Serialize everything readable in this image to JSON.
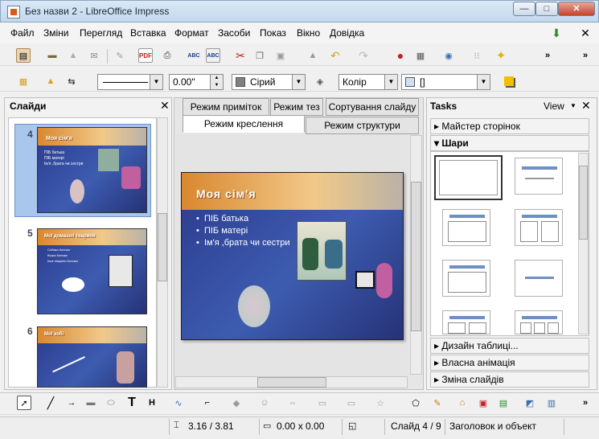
{
  "window": {
    "title": "Без назви 2 - LibreOffice Impress",
    "minimize": "—",
    "maximize": "□",
    "close": "✕"
  },
  "menu": {
    "items": [
      "Файл",
      "Зміни",
      "Перегляд",
      "Вставка",
      "Формат",
      "Засоби",
      "Показ",
      "Вікно",
      "Довідка"
    ]
  },
  "line_toolbar": {
    "line_width": "0.00\"",
    "area_style": "Сірий",
    "area_fill_type": "Колір",
    "area_value": "[]"
  },
  "slides_panel": {
    "title": "Слайди",
    "slides": [
      {
        "number": "4",
        "title": "Моя сім'я",
        "bullets": [
          "ПІБ батька",
          "ПІБ матері",
          "Ім'я ,брата чи сестри"
        ]
      },
      {
        "number": "5",
        "title": "Мої домашні тварини",
        "bullets": [
          "Собака Кличка",
          "Кішка Кличка",
          "Інші тварини Кличка"
        ]
      },
      {
        "number": "6",
        "title": "Мої хобі",
        "bullets": []
      }
    ]
  },
  "view_tabs": {
    "top": [
      "Режим приміток",
      "Режим тез",
      "Сортування слайду"
    ],
    "bottom": [
      "Режим креслення",
      "Режим структури"
    ]
  },
  "main_slide": {
    "title": "Моя сім'я",
    "bullets": [
      "ПІБ батька",
      "ПІБ матері",
      "Ім'я ,брата чи сестри"
    ]
  },
  "tasks_panel": {
    "title": "Tasks",
    "view_label": "View",
    "sections": [
      "Майстер сторінок",
      "Шари",
      "Дизайн таблиці...",
      "Власна анімація",
      "Зміна слайдів"
    ]
  },
  "status_bar": {
    "position": "3.16 / 3.81",
    "size": "0.00 x 0.00",
    "slide": "Слайд 4 / 9",
    "layout": "Заголовок и объект"
  },
  "colors": {
    "slide_bg": "#2e3f93",
    "title_bar": "#e8a84c",
    "selection": "#a7c5ea"
  }
}
